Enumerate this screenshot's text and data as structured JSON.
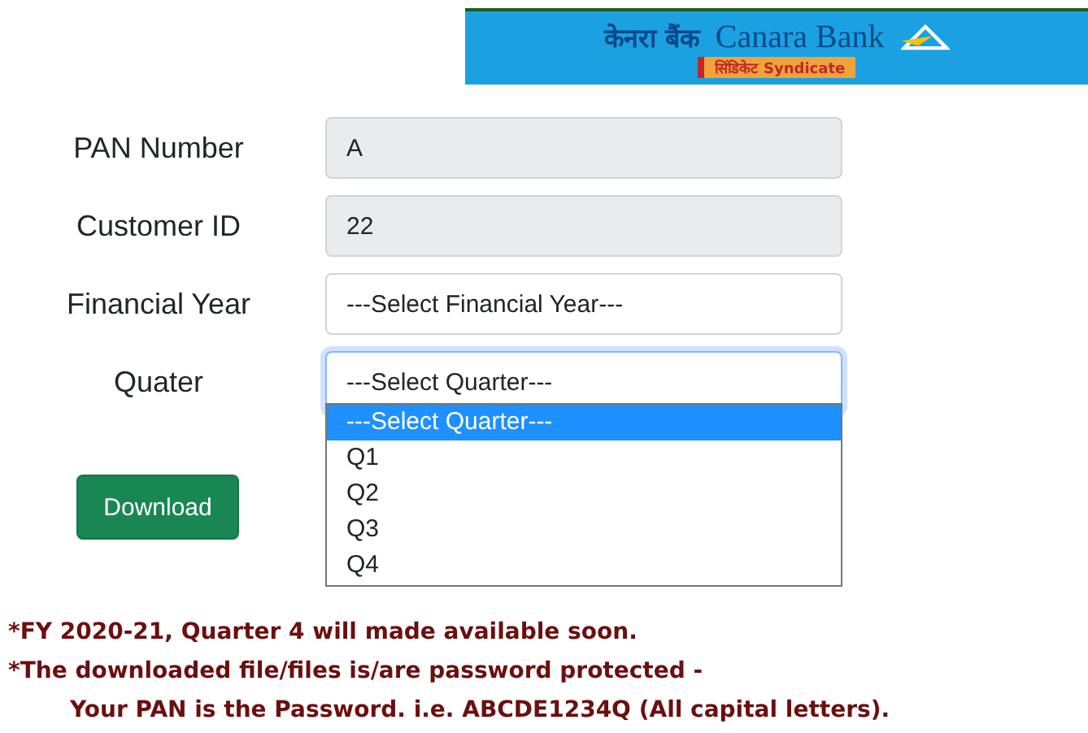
{
  "logo": {
    "hindi": "केनरा बैंक",
    "english": "Canara Bank",
    "badge_hindi": "सिंडिकेट",
    "badge_english": "Syndicate"
  },
  "fields": [
    {
      "label": "PAN Number",
      "kind": "readonly",
      "value": "A"
    },
    {
      "label": "Customer ID",
      "kind": "readonly",
      "value": "22"
    },
    {
      "label": "Financial Year",
      "kind": "select",
      "value": "---Select Financial Year---",
      "focused": false
    },
    {
      "label": "Quater",
      "kind": "select",
      "value": "---Select Quarter---",
      "focused": true
    }
  ],
  "dropdown": {
    "options": [
      {
        "label": "---Select Quarter---",
        "selected": true
      },
      {
        "label": "Q1",
        "selected": false
      },
      {
        "label": "Q2",
        "selected": false
      },
      {
        "label": "Q3",
        "selected": false
      },
      {
        "label": "Q4",
        "selected": false
      }
    ]
  },
  "download_button": "Download",
  "notes": [
    {
      "text": "*FY 2020-21, Quarter 4 will made available soon.",
      "indent": false
    },
    {
      "text": "*The downloaded file/files is/are password protected -",
      "indent": false
    },
    {
      "text": "Your PAN is the Password. i.e. ABCDE1234Q (All capital letters).",
      "indent": true
    }
  ]
}
